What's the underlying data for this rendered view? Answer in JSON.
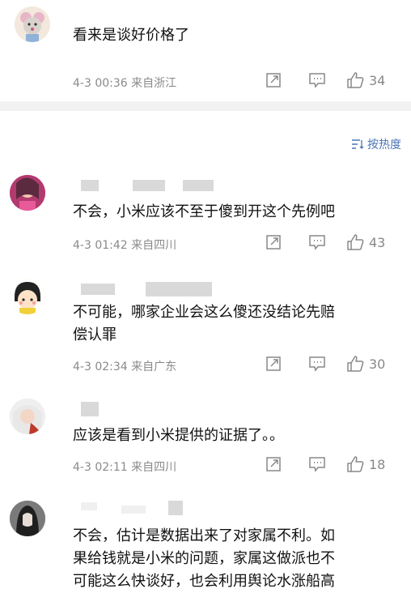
{
  "sort_label": "按热度",
  "comments": [
    {
      "text": "看来是谈好价格了",
      "meta": "4-3 00:36 来自浙江",
      "likes": "34",
      "avatar_color": "#efe3d8"
    },
    {
      "text": "不会，小米应该不至于傻到开这个先例吧",
      "meta": "4-3 01:42 来自四川",
      "likes": "43",
      "avatar_color": "#c2447a"
    },
    {
      "text": "不可能，哪家企业会这么傻还没结论先赔\n偿认罪",
      "meta": "4-3 02:34 来自广东",
      "likes": "30",
      "avatar_color": "#f4d45a"
    },
    {
      "text": "应该是看到小米提供的证据了。。",
      "meta": "4-3 02:11 来自四川",
      "likes": "18",
      "avatar_color": "#e4e4e4"
    },
    {
      "text": "不会，估计是数据出来了对家属不利。如\n果给钱就是小米的问题，家属这做派也不\n可能这么快谈好，也会利用舆论水涨船高",
      "meta": "",
      "likes": "",
      "avatar_color": "#5a5a5a"
    }
  ]
}
